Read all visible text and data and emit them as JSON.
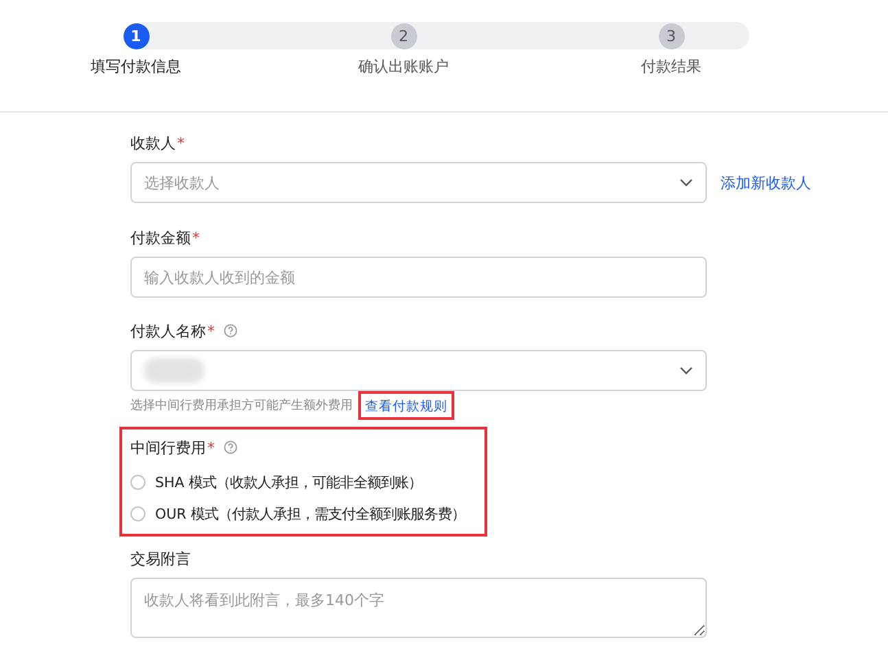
{
  "steps": [
    {
      "number": "1",
      "label": "填写付款信息",
      "active": true
    },
    {
      "number": "2",
      "label": "确认出账账户",
      "active": false
    },
    {
      "number": "3",
      "label": "付款结果",
      "active": false
    }
  ],
  "payee": {
    "label": "收款人",
    "required_mark": "*",
    "placeholder": "选择收款人",
    "link": "添加新收款人"
  },
  "amount": {
    "label": "付款金额",
    "required_mark": "*",
    "placeholder": "输入收款人收到的金额"
  },
  "payer_name": {
    "label": "付款人名称",
    "required_mark": "*",
    "help": true,
    "redacted": true,
    "hint": "选择中间行费用承担方可能产生额外费用",
    "link": "查看付款规则",
    "link_highlighted": true
  },
  "intermediary_fee": {
    "label": "中间行费用",
    "required_mark": "*",
    "help": true,
    "highlighted": true,
    "options": [
      {
        "label": "SHA 模式（收款人承担，可能非全额到账）",
        "selected": false
      },
      {
        "label": "OUR 模式（付款人承担，需支付全额到账服务费）",
        "selected": false
      }
    ]
  },
  "message": {
    "label": "交易附言",
    "placeholder": "收款人将看到此附言，最多140个字"
  }
}
